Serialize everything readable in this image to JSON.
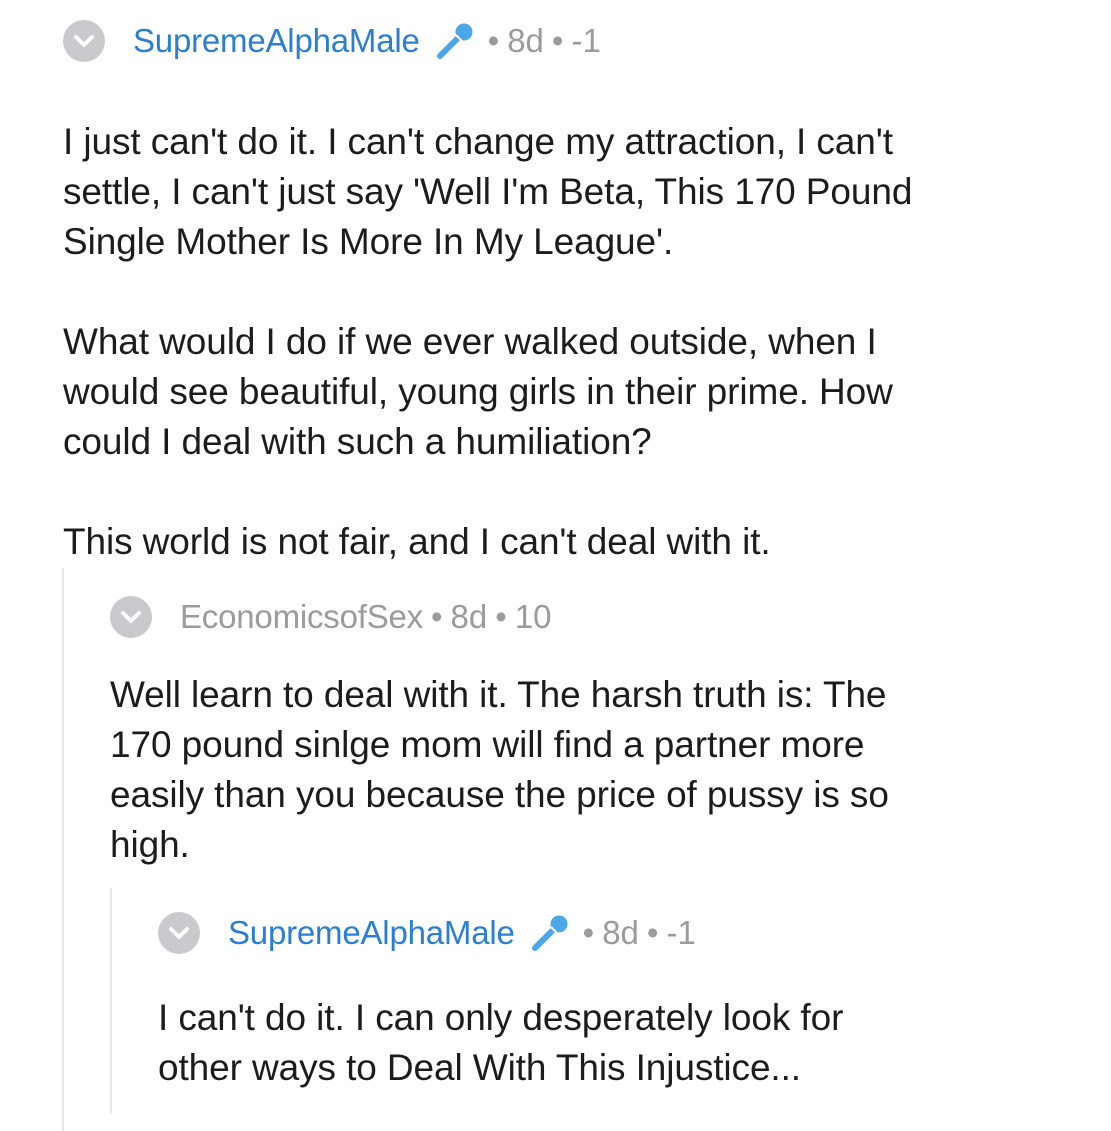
{
  "comments": [
    {
      "author": "SupremeAlphaMale",
      "age": "8d",
      "score": "-1",
      "paragraphs": [
        "I just can't do it. I can't change my attraction, I can't\nsettle, I can't just say 'Well I'm Beta, This 170 Pound\nSingle Mother Is More In My League'.",
        "What would I do if we ever walked outside, when I\nwould see beautiful, young girls in their prime. How\ncould I deal with such a humiliation?",
        "This world is not fair, and I can't deal with it."
      ]
    },
    {
      "author": "EconomicsofSex",
      "age": "8d",
      "score": "10",
      "paragraphs": [
        "Well learn to deal with it. The harsh truth is: The\n170 pound sinlge mom will find a partner more\neasily than you because the price of pussy is so\nhigh."
      ]
    },
    {
      "author": "SupremeAlphaMale",
      "age": "8d",
      "score": "-1",
      "paragraphs": [
        "I can't do it. I can only desperately look for\nother ways to Deal With This Injustice..."
      ]
    }
  ],
  "separator": "•",
  "icons": {
    "collapse": "chevron-down-icon",
    "flair": "microphone-icon"
  },
  "colors": {
    "username": "#2a7fd4",
    "username_muted": "#9a9a9f",
    "meta": "#9a9a9f",
    "collapse_bg": "#c9c9ce",
    "flair": "#4aa8e8"
  }
}
